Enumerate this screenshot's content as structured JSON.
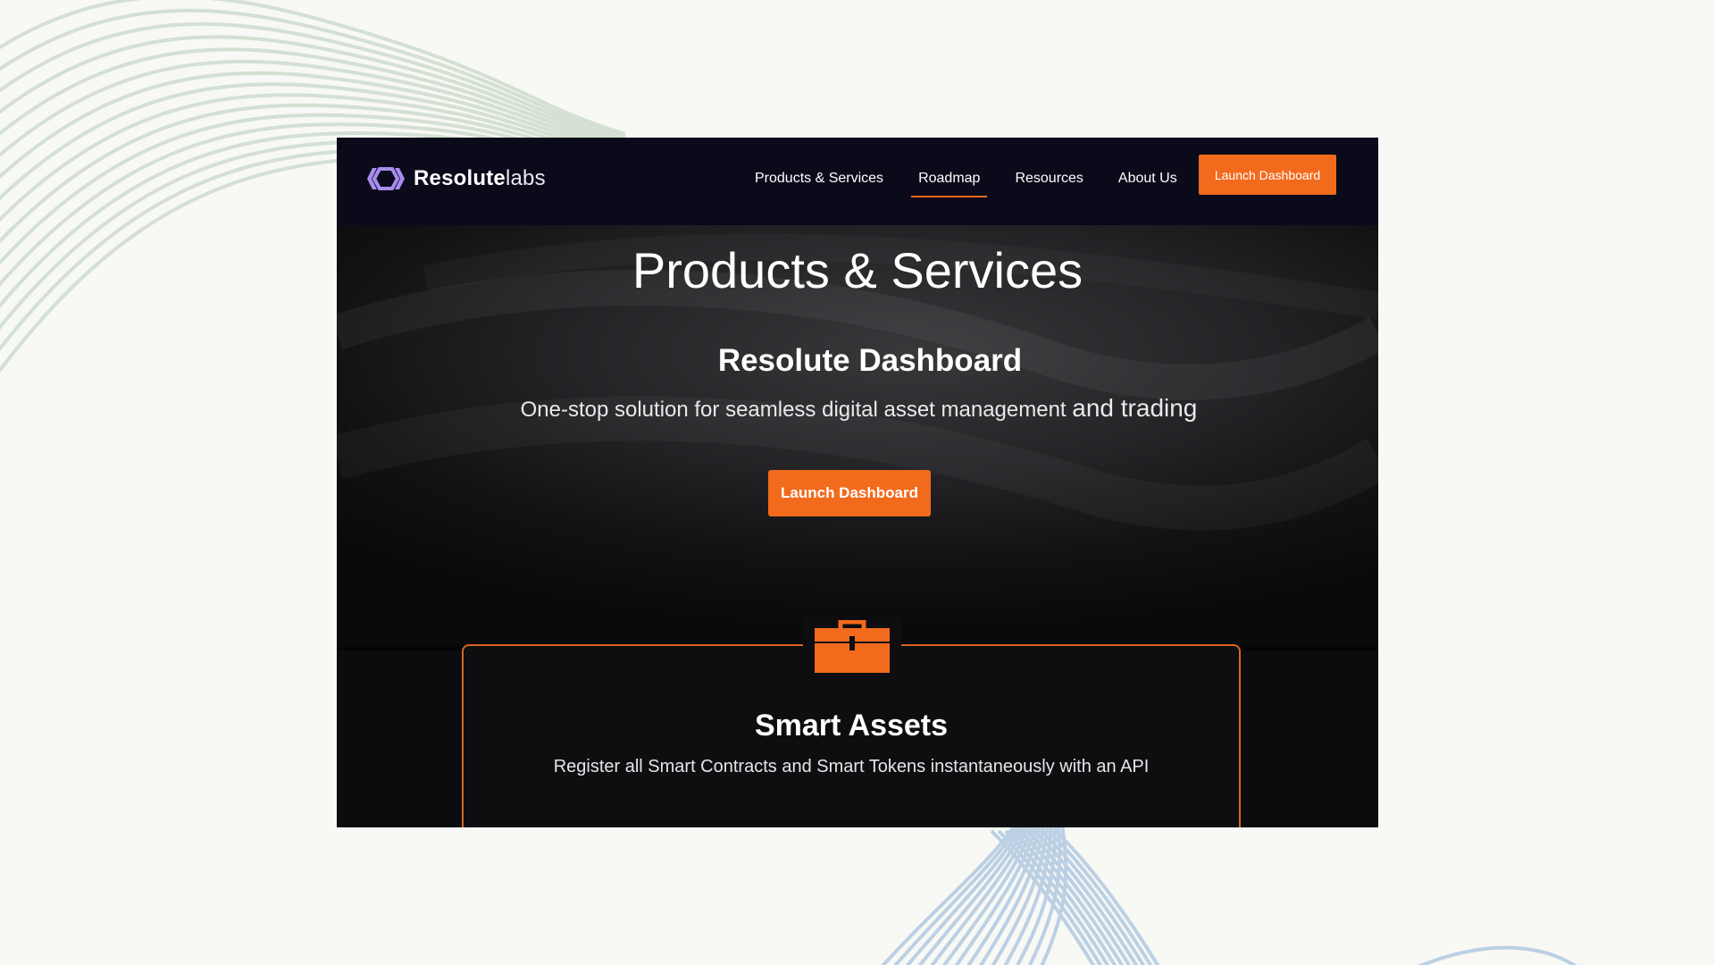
{
  "logo": {
    "name_strong": "Resolute",
    "name_light": "labs"
  },
  "nav": {
    "items": [
      {
        "label": "Products & Services",
        "active": false
      },
      {
        "label": "Roadmap",
        "active": true
      },
      {
        "label": "Resources",
        "active": false
      },
      {
        "label": "About Us",
        "active": false
      }
    ],
    "cta_label": "Launch Dashboard"
  },
  "hero": {
    "title": "Products & Services",
    "subtitle": "Resolute Dashboard",
    "description_part1": "One-stop solution for seamless digital asset management ",
    "description_part2": "and trading",
    "cta_label": "Launch Dashboard"
  },
  "feature_card": {
    "icon": "briefcase-icon",
    "title": "Smart Assets",
    "description": "Register all Smart Contracts and Smart Tokens instantaneously with an API"
  },
  "colors": {
    "accent": "#f26b1d",
    "navbar_bg": "#0b0a1a",
    "logo_mark": "#a98cf0",
    "page_bg": "#f8f8f5"
  }
}
